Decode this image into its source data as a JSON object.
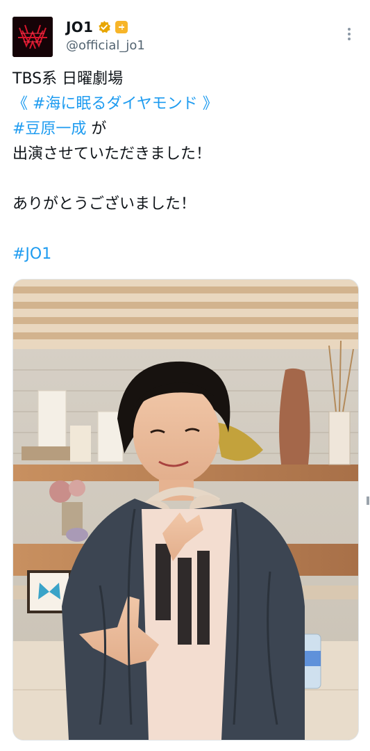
{
  "account": {
    "display_name": "JO1",
    "handle": "@official_jo1",
    "avatar_icon": "jo1-logo-avatar",
    "verified_icon": "gold-verified-badge-icon",
    "affiliate_icon": "affiliate-badge-icon"
  },
  "tweet": {
    "line1": "TBS系 日曜劇場",
    "line2_open": "《 ",
    "line2_tag": "#海に眠るダイヤモンド",
    "line2_close": " 》",
    "line3_tag": "#豆原一成",
    "line3_rest": " が",
    "line4": "出演させていただきました！",
    "line6": "ありがとうございました！",
    "line8_tag": "#JO1"
  },
  "media": {
    "description_icon": "photo-image"
  },
  "colors": {
    "link": "#1d9bf0",
    "text": "#0f1419",
    "secondary": "#536471",
    "gold": "#e8a600"
  }
}
